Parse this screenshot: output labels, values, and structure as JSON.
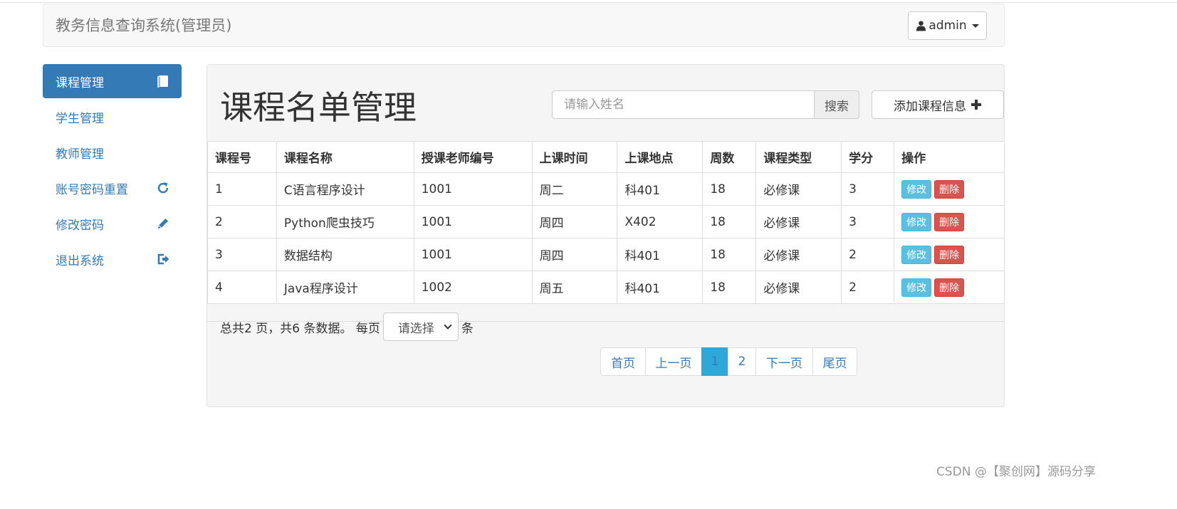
{
  "header": {
    "title": "教务信息查询系统(管理员)",
    "user_label": "admin"
  },
  "sidebar": {
    "items": [
      {
        "label": "课程管理",
        "icon": "book-icon",
        "active": true
      },
      {
        "label": "学生管理"
      },
      {
        "label": "教师管理"
      },
      {
        "label": "账号密码重置",
        "icon": "refresh-icon"
      },
      {
        "label": "修改密码",
        "icon": "pencil-icon"
      },
      {
        "label": "退出系统",
        "icon": "logout-icon"
      }
    ]
  },
  "main": {
    "title": "课程名单管理",
    "search": {
      "placeholder": "请输入姓名",
      "button_label": "搜索"
    },
    "add_button_label": "添加课程信息",
    "table": {
      "columns": [
        "课程号",
        "课程名称",
        "授课老师编号",
        "上课时间",
        "上课地点",
        "周数",
        "课程类型",
        "学分",
        "操作"
      ],
      "rows": [
        [
          "1",
          "C语言程序设计",
          "1001",
          "周二",
          "科401",
          "18",
          "必修课",
          "3"
        ],
        [
          "2",
          "Python爬虫技巧",
          "1001",
          "周四",
          "X402",
          "18",
          "必修课",
          "3"
        ],
        [
          "3",
          "数据结构",
          "1001",
          "周四",
          "科401",
          "18",
          "必修课",
          "2"
        ],
        [
          "4",
          "Java程序设计",
          "1002",
          "周五",
          "科401",
          "18",
          "必修课",
          "2"
        ]
      ],
      "edit_label": "修改",
      "delete_label": "删除"
    },
    "pagination": {
      "summary": "总共2 页，共6 条数据。 每页",
      "select_placeholder": "请选择",
      "unit": "条",
      "first": "首页",
      "prev": "上一页",
      "pages": [
        "1",
        "2"
      ],
      "current": "1",
      "next": "下一页",
      "last": "尾页"
    }
  },
  "watermark": "CSDN @【聚创网】源码分享",
  "colors": {
    "primary": "#337ab7",
    "info": "#5bc0de",
    "danger": "#d9534f",
    "active_page": "#2ea8d6"
  }
}
